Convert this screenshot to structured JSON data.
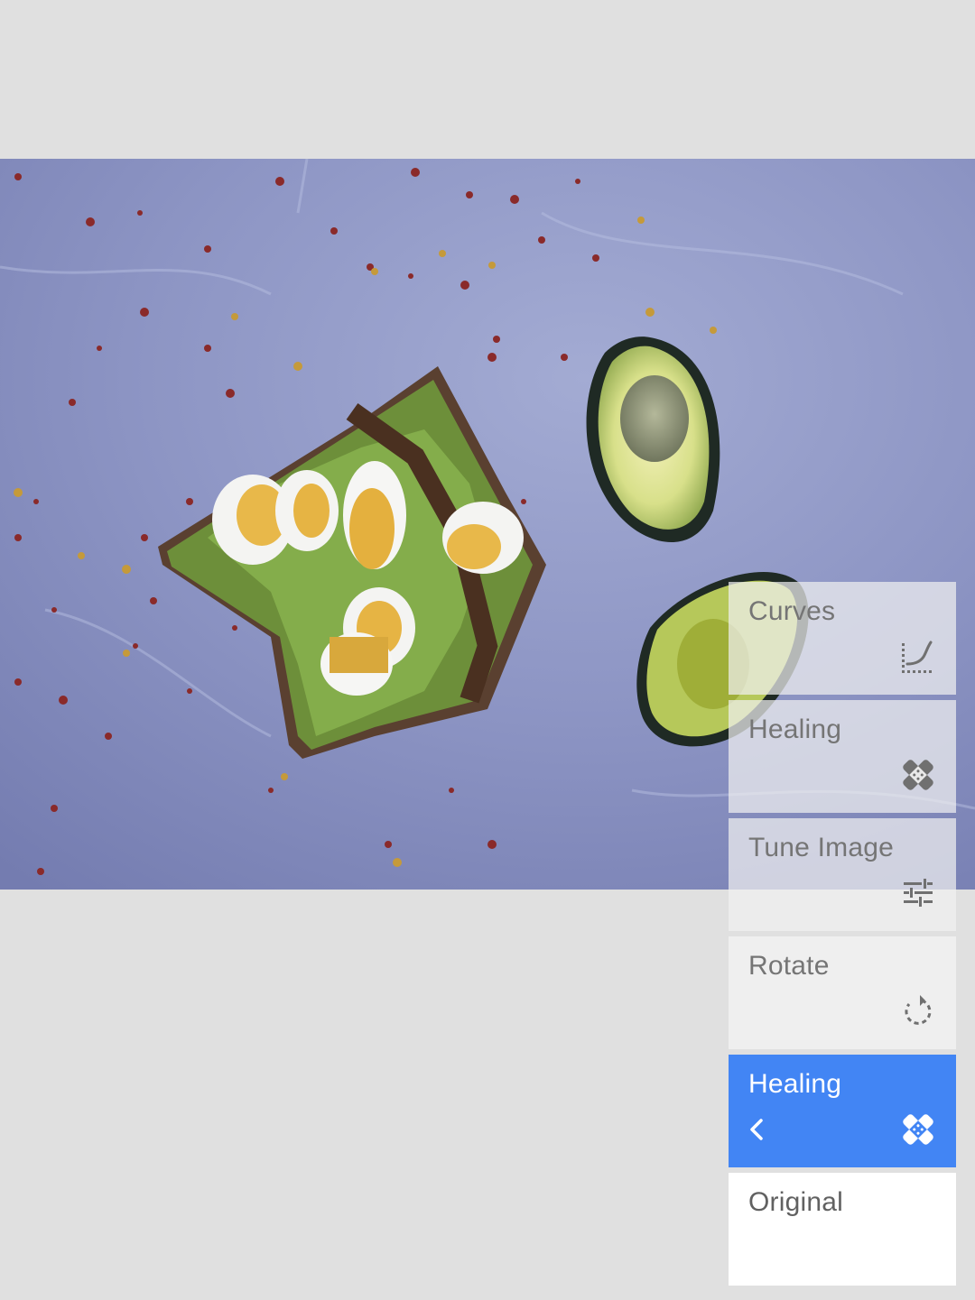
{
  "editor": {
    "history": [
      {
        "label": "Curves",
        "icon": "curves-icon",
        "state": "faded"
      },
      {
        "label": "Healing",
        "icon": "healing-icon",
        "state": "faded"
      },
      {
        "label": "Tune Image",
        "icon": "tune-image-icon",
        "state": "faded"
      },
      {
        "label": "Rotate",
        "icon": "rotate-icon",
        "state": "normal"
      },
      {
        "label": "Healing",
        "icon": "healing-icon",
        "state": "active"
      },
      {
        "label": "Original",
        "icon": "",
        "state": "original"
      }
    ],
    "colors": {
      "accent": "#4285f4",
      "background": "#e0e0e0",
      "card": "#efefef",
      "label": "#757575"
    }
  }
}
